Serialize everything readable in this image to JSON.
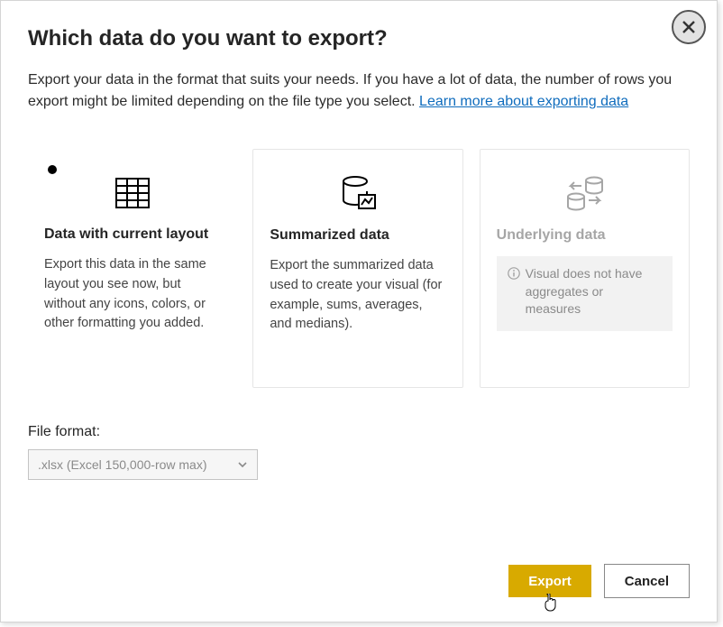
{
  "dialog": {
    "title": "Which data do you want to export?",
    "description_pre": "Export your data in the format that suits your needs. If you have a lot of data, the number of rows you export might be limited depending on the file type you select.  ",
    "learn_more": "Learn more about exporting data"
  },
  "cards": [
    {
      "title": "Data with current layout",
      "body": "Export this data in the same layout you see now, but without any icons, colors, or other formatting you added.",
      "icon": "table-icon",
      "selected": true,
      "disabled": false
    },
    {
      "title": "Summarized data",
      "body": "Export the summarized data used to create your visual (for example, sums, averages, and medians).",
      "icon": "db-chart-icon",
      "selected": false,
      "disabled": false
    },
    {
      "title": "Underlying data",
      "info": "Visual does not have aggregates or measures",
      "icon": "db-swap-icon",
      "selected": false,
      "disabled": true
    }
  ],
  "file_format": {
    "label": "File format:",
    "selected": ".xlsx (Excel 150,000-row max)"
  },
  "buttons": {
    "export": "Export",
    "cancel": "Cancel"
  }
}
